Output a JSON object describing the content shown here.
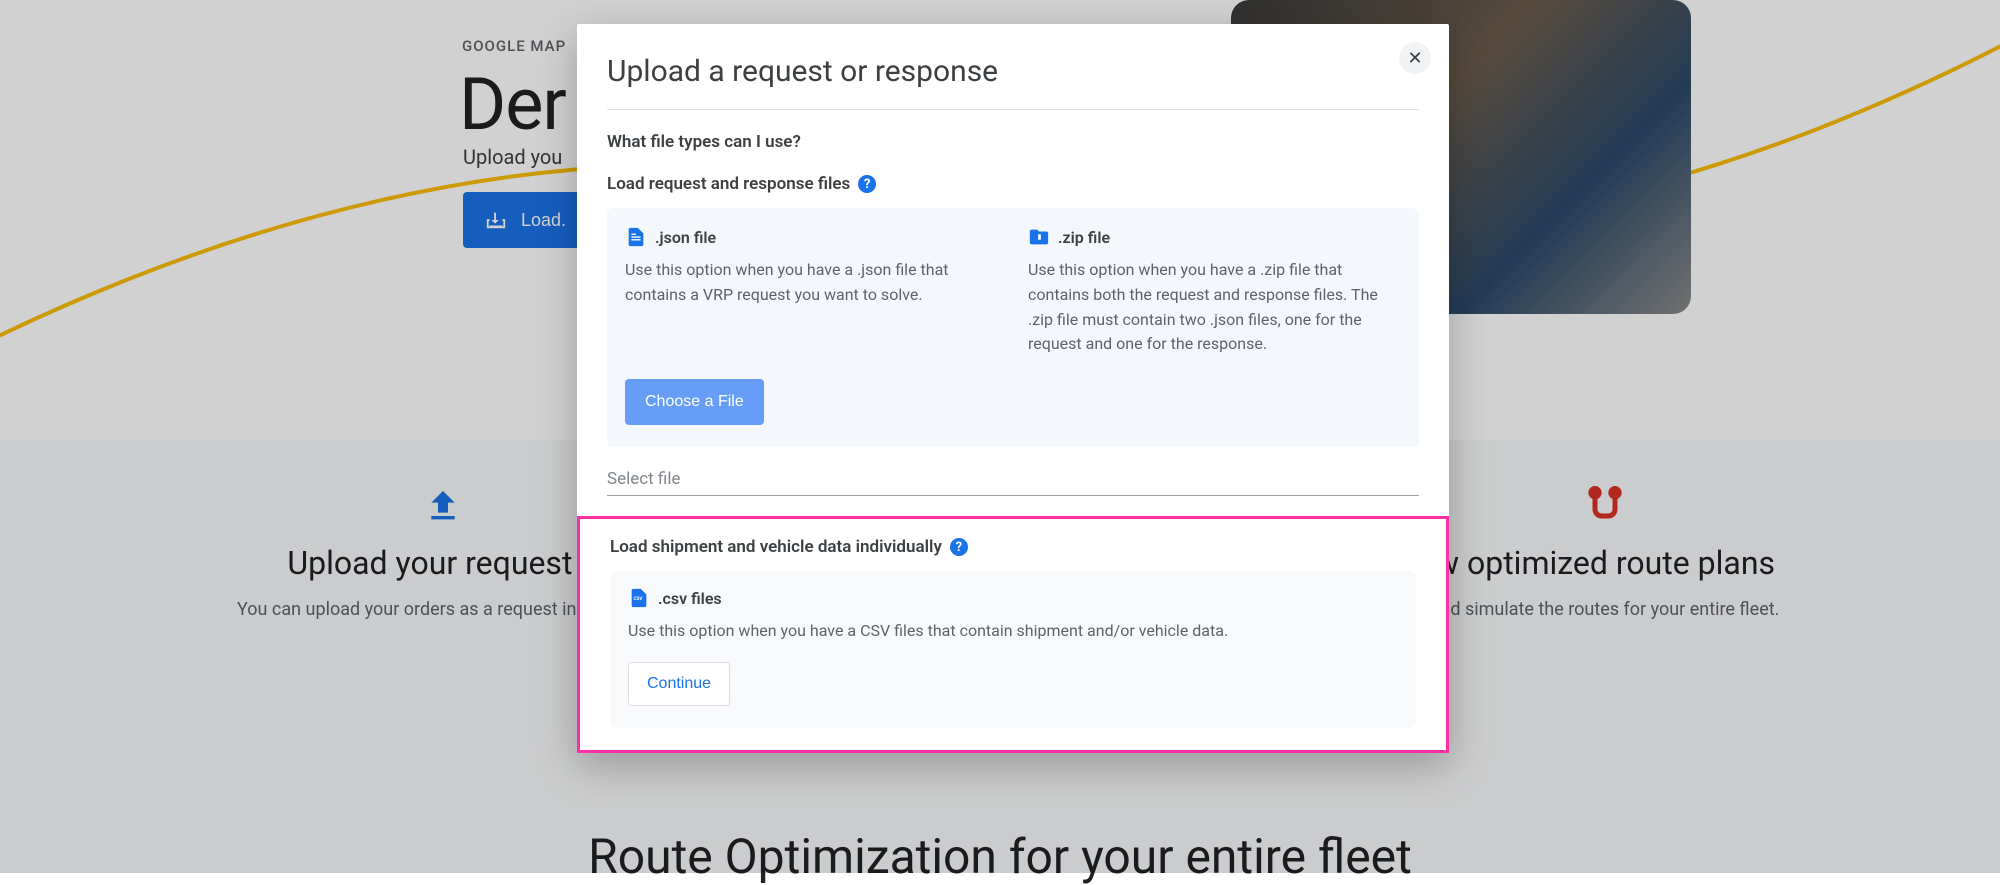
{
  "page": {
    "eyebrow": "GOOGLE MAP",
    "hero_title_part": "Der",
    "hero_sub_part": "Upload you",
    "load_button": "Load."
  },
  "features": {
    "left": {
      "title": "Upload your request o",
      "desc": "You can upload your orders as a request in .\nformat."
    },
    "right": {
      "title": "w optimized route plans",
      "desc": "and simulate the routes for your entire fleet."
    }
  },
  "big_title": "Route Optimization for your entire fleet",
  "modal": {
    "title": "Upload a request or response",
    "question": "What file types can I use?",
    "section1_label": "Load request and response files",
    "json": {
      "title": ".json file",
      "desc": "Use this option when you have a .json file that contains a VRP request you want to solve."
    },
    "zip": {
      "title": ".zip file",
      "desc": "Use this option when you have a .zip file that contains both the request and response files. The .zip file must contain two .json files, one for the request and one for the response."
    },
    "choose_button": "Choose a File",
    "select_placeholder": "Select file",
    "section2_label": "Load shipment and vehicle data individually",
    "csv": {
      "title": ".csv files",
      "desc": "Use this option when you have a CSV files that contain shipment and/or vehicle data."
    },
    "continue_button": "Continue"
  }
}
